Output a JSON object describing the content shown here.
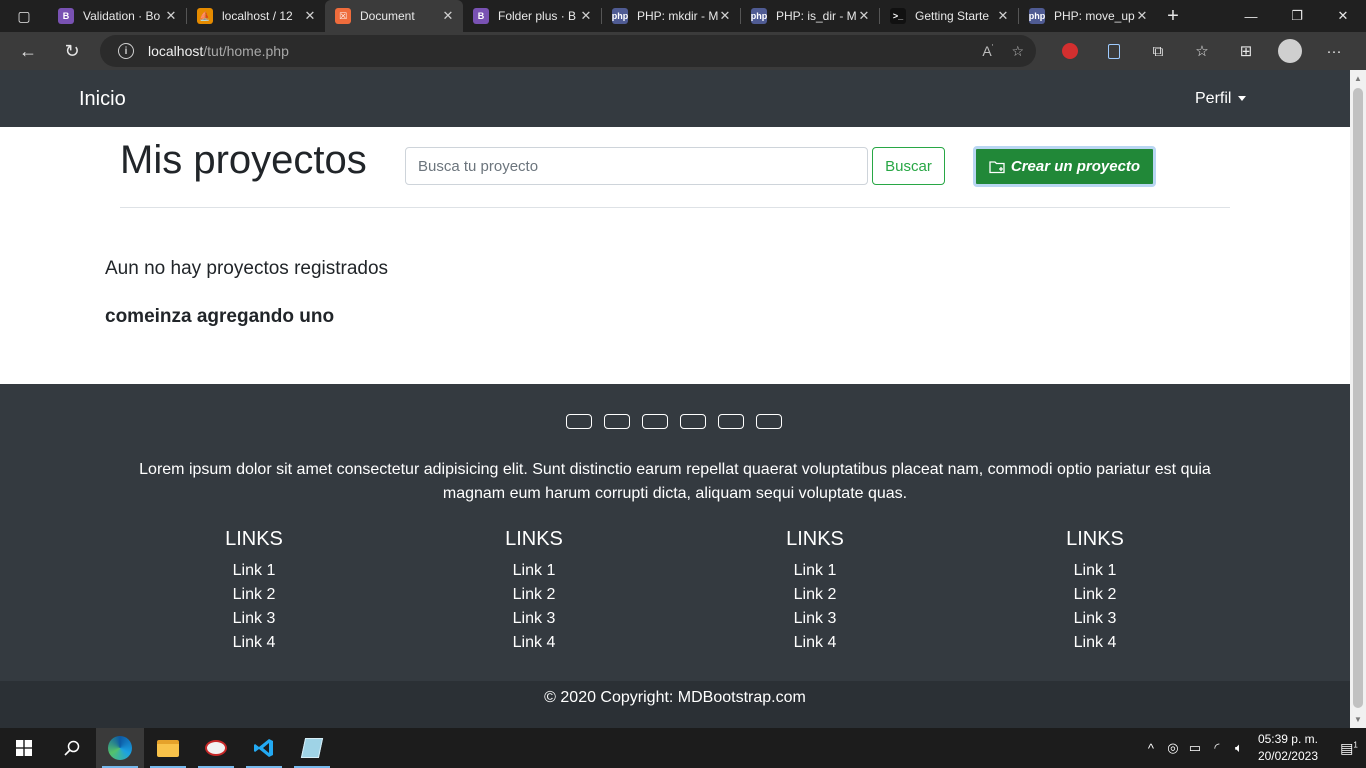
{
  "browser": {
    "tabs": [
      {
        "title": "Validation · Bo",
        "favicon_color": "#7952b3",
        "favicon_text": "B"
      },
      {
        "title": "localhost / 12",
        "favicon_color": "#e58b00",
        "favicon_text": "⛵"
      },
      {
        "title": "Document",
        "favicon_color": "#ef6c3c",
        "favicon_text": "☒",
        "active": true
      },
      {
        "title": "Folder plus · B",
        "favicon_color": "#7952b3",
        "favicon_text": "B"
      },
      {
        "title": "PHP: mkdir - M",
        "favicon_color": "#4f5b93",
        "favicon_text": "php"
      },
      {
        "title": "PHP: is_dir - M",
        "favicon_color": "#4f5b93",
        "favicon_text": "php"
      },
      {
        "title": "Getting Starte",
        "favicon_color": "#111111",
        "favicon_text": ">_"
      },
      {
        "title": "PHP: move_up",
        "favicon_color": "#4f5b93",
        "favicon_text": "php"
      }
    ],
    "url_host": "localhost",
    "url_path": "/tut/home.php"
  },
  "navbar": {
    "brand": "Inicio",
    "profile": "Perfil"
  },
  "main": {
    "title": "Mis proyectos",
    "search_placeholder": "Busca tu proyecto",
    "search_button": "Buscar",
    "create_button": "Crear un proyecto",
    "empty_line1": "Aun no hay proyectos registrados",
    "empty_line2": "comeinza agregando uno"
  },
  "footer": {
    "description": "Lorem ipsum dolor sit amet consectetur adipisicing elit. Sunt distinctio earum repellat quaerat voluptatibus placeat nam, commodi optio pariatur est quia magnam eum harum corrupti dicta, aliquam sequi voluptate quas.",
    "columns": [
      {
        "heading": "LINKS",
        "links": [
          "Link 1",
          "Link 2",
          "Link 3",
          "Link 4"
        ]
      },
      {
        "heading": "LINKS",
        "links": [
          "Link 1",
          "Link 2",
          "Link 3",
          "Link 4"
        ]
      },
      {
        "heading": "LINKS",
        "links": [
          "Link 1",
          "Link 2",
          "Link 3",
          "Link 4"
        ]
      },
      {
        "heading": "LINKS",
        "links": [
          "Link 1",
          "Link 2",
          "Link 3",
          "Link 4"
        ]
      }
    ],
    "copyright": "© 2020 Copyright: MDBootstrap.com"
  },
  "taskbar": {
    "time": "05:39 p. m.",
    "date": "20/02/2023",
    "notifications": "1"
  },
  "colors": {
    "navbar_bg": "#343a40",
    "success": "#28a745",
    "success_dark": "#218838"
  }
}
